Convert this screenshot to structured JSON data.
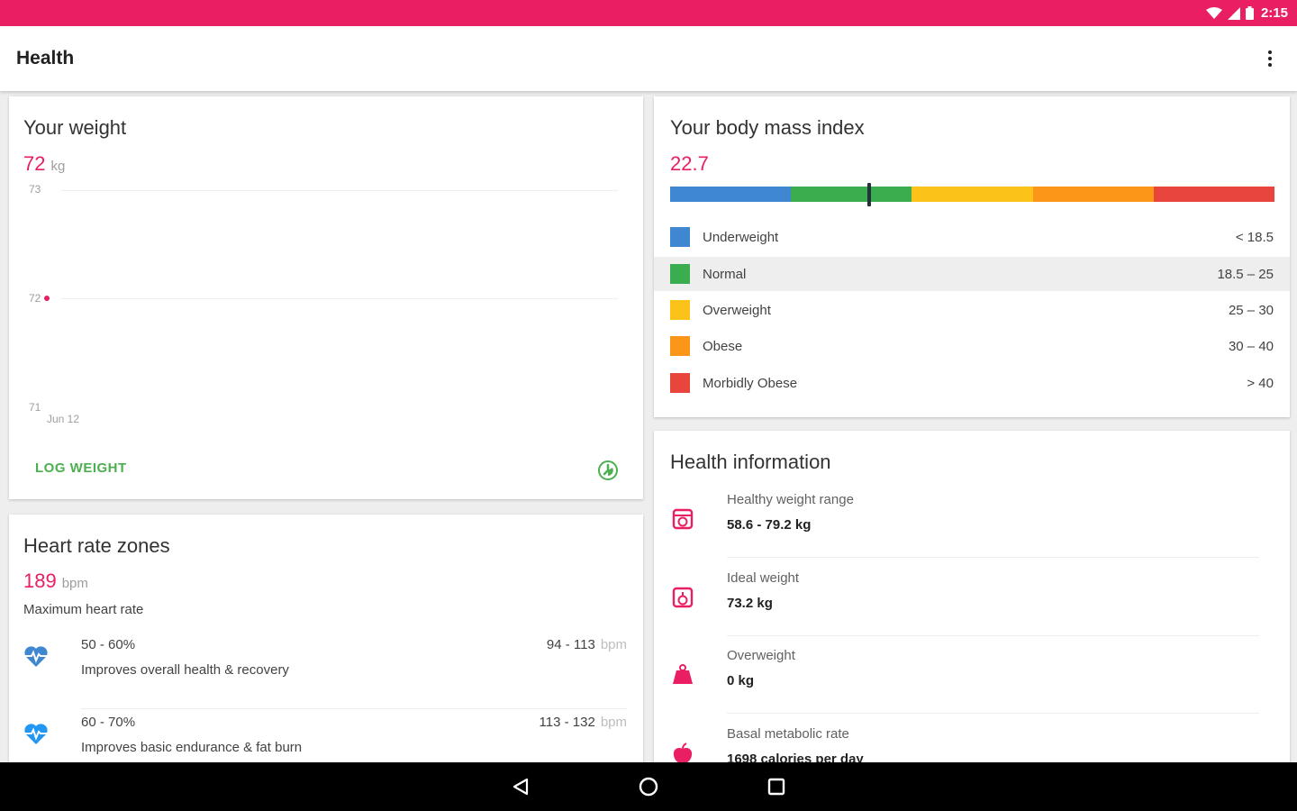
{
  "status_bar": {
    "time": "2:15"
  },
  "app_bar": {
    "title": "Health"
  },
  "weight_card": {
    "title": "Your weight",
    "value": "72",
    "unit": "kg",
    "chart_ticks": [
      "73",
      "72",
      "71"
    ],
    "x_label": "Jun 12",
    "log_label": "LOG WEIGHT"
  },
  "bmi_card": {
    "title": "Your body mass index",
    "value": "22.7",
    "bmi_value": 22.7,
    "categories": [
      {
        "label": "Underweight",
        "range": "< 18.5",
        "color": "#3f87d0"
      },
      {
        "label": "Normal",
        "range": "18.5 – 25",
        "color": "#3aae4f"
      },
      {
        "label": "Overweight",
        "range": "25 – 30",
        "color": "#fbc31a"
      },
      {
        "label": "Obese",
        "range": "30 – 40",
        "color": "#fb9618"
      },
      {
        "label": "Morbidly Obese",
        "range": "> 40",
        "color": "#e8453c"
      }
    ],
    "bar_colors": [
      "#3f87d0",
      "#3aae4f",
      "#fbc31a",
      "#fb9618",
      "#e8453c"
    ]
  },
  "heart_card": {
    "title": "Heart rate zones",
    "value": "189",
    "unit": "bpm",
    "caption": "Maximum heart rate",
    "zones": [
      {
        "pct": "50 - 60%",
        "desc": "Improves overall health & recovery",
        "bpm": "94 - 113",
        "unit": "bpm"
      },
      {
        "pct": "60 - 70%",
        "desc": "Improves basic endurance & fat burn",
        "bpm": "113 - 132",
        "unit": "bpm"
      }
    ]
  },
  "info_card": {
    "title": "Health information",
    "items": [
      {
        "label": "Healthy weight range",
        "value": "58.6 - 79.2 kg",
        "icon": "scale-icon"
      },
      {
        "label": "Ideal weight",
        "value": "73.2 kg",
        "icon": "scale-check-icon"
      },
      {
        "label": "Overweight",
        "value": "0 kg",
        "icon": "weight-icon"
      },
      {
        "label": "Basal metabolic rate",
        "value": "1698 calories per day",
        "icon": "apple-icon"
      }
    ]
  },
  "colors": {
    "accent": "#e91e63",
    "green": "#4caf50"
  }
}
